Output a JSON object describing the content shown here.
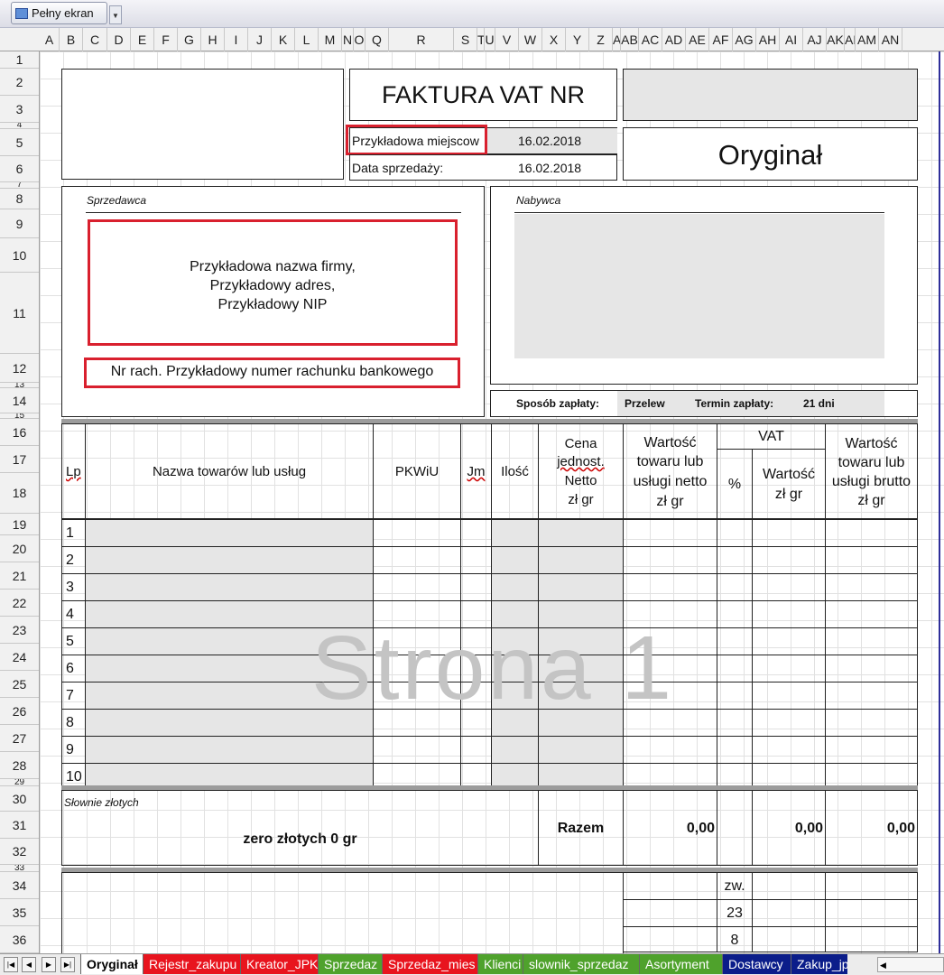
{
  "toolbar": {
    "fullscreen_label": "Pełny ekran",
    "dropdown_icon": "chevron-down-icon"
  },
  "columns": [
    "A",
    "B",
    "C",
    "D",
    "E",
    "F",
    "G",
    "H",
    "I",
    "J",
    "K",
    "L",
    "M",
    "N",
    "O",
    "Q",
    "R",
    "S",
    "T",
    "U",
    "V",
    "W",
    "X",
    "Y",
    "Z",
    "AA",
    "AB",
    "AC",
    "AD",
    "AE",
    "AF",
    "AG",
    "AH",
    "AI",
    "AJ",
    "AK",
    "AL",
    "AM",
    "AN"
  ],
  "rows": [
    "1",
    "2",
    "3",
    "4",
    "5",
    "6",
    "7",
    "8",
    "9",
    "10",
    "11",
    "12",
    "13",
    "14",
    "15",
    "16",
    "17",
    "18",
    "19",
    "20",
    "21",
    "22",
    "23",
    "24",
    "25",
    "26",
    "27",
    "28",
    "29",
    "30",
    "31",
    "32",
    "33",
    "34",
    "35",
    "36"
  ],
  "invoice": {
    "title": "FAKTURA VAT NR",
    "place_label": "Przykładowa miejscow",
    "issue_date": "16.02.2018",
    "sale_date_label": "Data sprzedaży:",
    "sale_date": "16.02.2018",
    "copy_type": "Oryginał",
    "seller_label": "Sprzedawca",
    "seller_name": "Przykładowa nazwa firmy,",
    "seller_address": "Przykładowy adres,",
    "seller_nip": "Przykładowy NIP",
    "bank_account": "Nr rach. Przykładowy numer rachunku bankowego",
    "buyer_label": "Nabywca",
    "payment_method_label": "Sposób zapłaty:",
    "payment_method": "Przelew",
    "payment_term_label": "Termin zapłaty:",
    "payment_term": "21 dni",
    "headers": {
      "lp": "Lp",
      "name": "Nazwa towarów lub usług",
      "pkwiu": "PKWiU",
      "jm": "Jm",
      "qty": "Ilość",
      "unit_price": [
        "Cena",
        "jednost.",
        "Netto",
        "zł gr"
      ],
      "net_value": [
        "Wartość",
        "towaru lub",
        "usługi netto",
        "zł gr"
      ],
      "vat": "VAT",
      "vat_pct": "%",
      "vat_value": [
        "Wartość",
        "zł gr"
      ],
      "gross_value": [
        "Wartość",
        "towaru lub",
        "usługi brutto",
        "zł gr"
      ]
    },
    "line_numbers": [
      "1",
      "2",
      "3",
      "4",
      "5",
      "6",
      "7",
      "8",
      "9",
      "10"
    ],
    "in_words_label": "Słownie złotych",
    "in_words": "zero złotych 0 gr",
    "total_label": "Razem",
    "total_net": "0,00",
    "total_vat": "0,00",
    "total_gross": "0,00",
    "vat_rates": [
      "zw.",
      "23",
      "8"
    ]
  },
  "watermark": "Strona 1",
  "sheet_tabs": [
    {
      "label": "Oryginał",
      "color": "#ffffff",
      "text": "#000000",
      "active": true
    },
    {
      "label": "Rejestr_zakupu",
      "color": "#e8141e",
      "text": "#ffffff"
    },
    {
      "label": "Kreator_JPK",
      "color": "#e8141e",
      "text": "#ffffff"
    },
    {
      "label": "Sprzedaz",
      "color": "#4fa22c",
      "text": "#ffffff"
    },
    {
      "label": "Sprzedaz_mies",
      "color": "#e8141e",
      "text": "#ffffff"
    },
    {
      "label": "Klienci",
      "color": "#4fa22c",
      "text": "#ffffff"
    },
    {
      "label": "slownik_sprzedaz",
      "color": "#4fa22c",
      "text": "#ffffff"
    },
    {
      "label": "Asortyment",
      "color": "#4fa22c",
      "text": "#ffffff"
    },
    {
      "label": "Dostawcy",
      "color": "#0b1d8a",
      "text": "#ffffff"
    },
    {
      "label": "Zakup_jp",
      "color": "#0b1d8a",
      "text": "#ffffff"
    }
  ]
}
